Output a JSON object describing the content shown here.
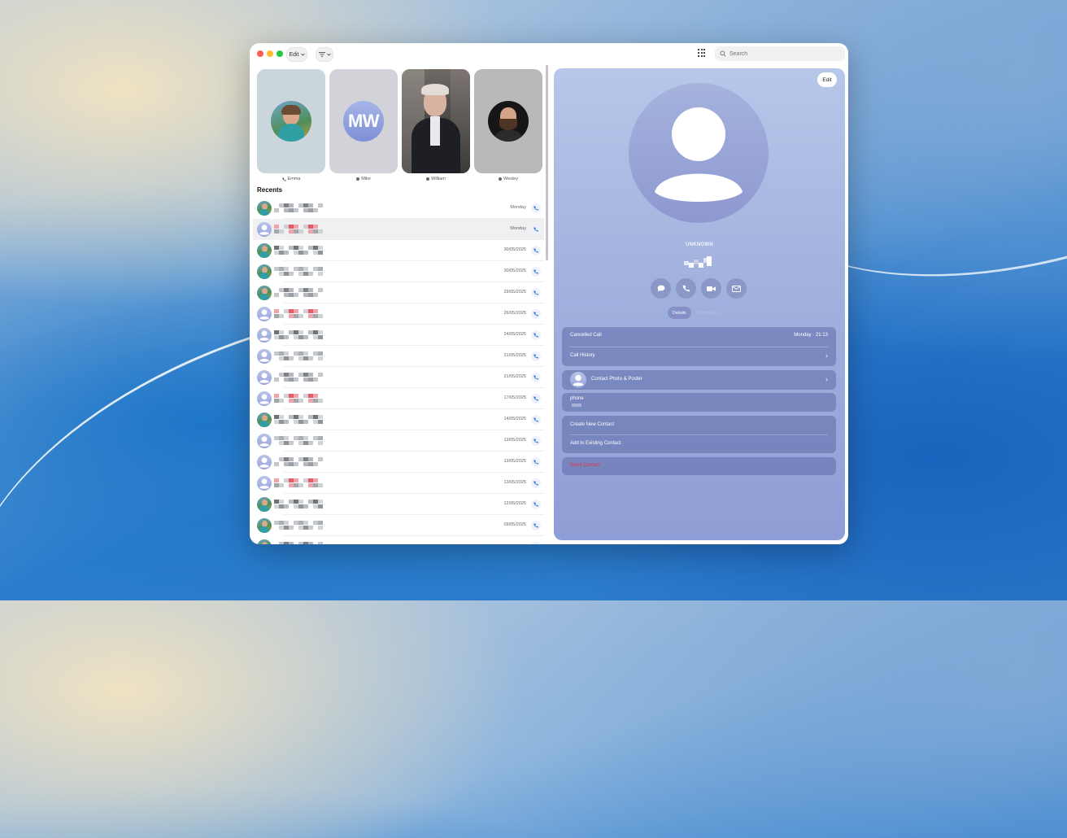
{
  "toolbar": {
    "edit_label": "Edit",
    "search_placeholder": "Search"
  },
  "favorites": [
    {
      "name": "Emma",
      "via": "phone"
    },
    {
      "name": "Mike",
      "initials": "MW",
      "via": "message"
    },
    {
      "name": "William",
      "via": "message"
    },
    {
      "name": "Wesley",
      "via": "message"
    }
  ],
  "recents": {
    "title": "Recents",
    "items": [
      {
        "date": "Monday",
        "avatar": "photo"
      },
      {
        "date": "Monday",
        "avatar": "generic",
        "selected": true
      },
      {
        "date": "30/05/2025",
        "avatar": "photo"
      },
      {
        "date": "30/05/2025",
        "avatar": "photo"
      },
      {
        "date": "29/05/2025",
        "avatar": "photo"
      },
      {
        "date": "26/05/2025",
        "avatar": "generic"
      },
      {
        "date": "24/05/2025",
        "avatar": "generic"
      },
      {
        "date": "21/05/2025",
        "avatar": "generic"
      },
      {
        "date": "21/05/2025",
        "avatar": "generic"
      },
      {
        "date": "17/05/2025",
        "avatar": "generic"
      },
      {
        "date": "14/05/2025",
        "avatar": "photo"
      },
      {
        "date": "13/05/2025",
        "avatar": "generic"
      },
      {
        "date": "13/05/2025",
        "avatar": "generic"
      },
      {
        "date": "13/05/2025",
        "avatar": "generic"
      },
      {
        "date": "12/05/2025",
        "avatar": "photo"
      },
      {
        "date": "09/05/2025",
        "avatar": "photo"
      },
      {
        "date": "",
        "avatar": "photo"
      }
    ]
  },
  "detail": {
    "edit_label": "Edit",
    "contact_name": "UNKNOWN",
    "tabs": {
      "active": "Details",
      "inactive": "Voicemails"
    },
    "call_info": {
      "label": "Cancelled Call",
      "time": "Monday · 21:13"
    },
    "call_history_label": "Call History",
    "photo_poster_label": "Contact Photo & Poster",
    "phone_label": "phone",
    "create_contact_label": "Create New Contact",
    "add_existing_label": "Add to Existing Contact",
    "block_label": "Block Contact"
  },
  "colors": {
    "accent": "#2f6fd6",
    "danger": "#e0314b",
    "detail_bg": "#a4b4df"
  }
}
